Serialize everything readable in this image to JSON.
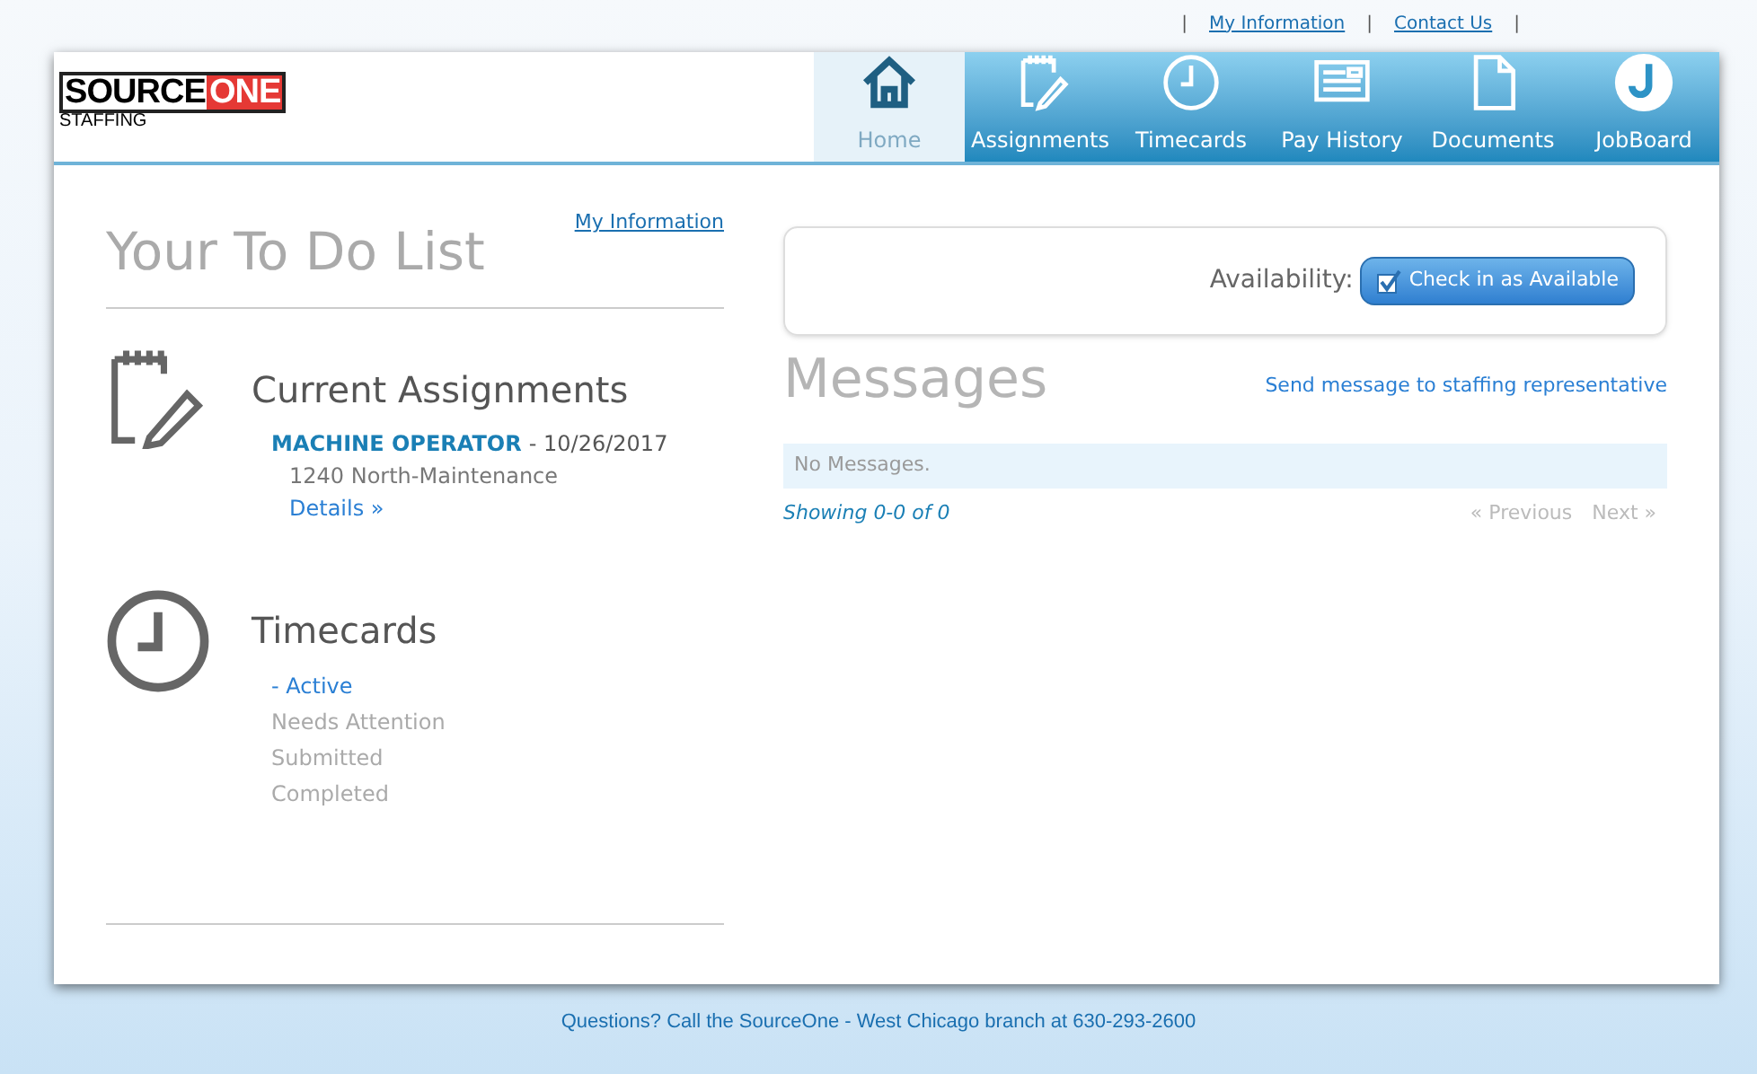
{
  "top_bar": [
    {
      "kind": "separator",
      "text": "|"
    },
    {
      "kind": "link",
      "text": "My Information"
    },
    {
      "kind": "separator",
      "text": "|"
    },
    {
      "kind": "link",
      "text": "Contact Us"
    },
    {
      "kind": "separator",
      "text": "|"
    }
  ],
  "logo": {
    "brand_a": "SOURCE",
    "brand_b": "ONE",
    "tagline": "STAFFING"
  },
  "nav": [
    {
      "label": "Home",
      "selected": true
    },
    {
      "label": "Assignments",
      "selected": false
    },
    {
      "label": "Timecards",
      "selected": false
    },
    {
      "label": "Pay History",
      "selected": false
    },
    {
      "label": "Documents",
      "selected": false
    },
    {
      "label": "JobBoard",
      "selected": false
    }
  ],
  "todo": {
    "title": "Your To Do List",
    "link": "My Information",
    "assignments": {
      "title": "Current Assignments",
      "job": "MACHINE OPERATOR",
      "date": "- 10/26/2017",
      "location": "1240 North-Maintenance",
      "details": "Details »"
    },
    "timecards": {
      "title": "Timecards",
      "items": [
        {
          "label": "- Active",
          "selected": true
        },
        {
          "label": "Needs Attention",
          "selected": false
        },
        {
          "label": "Submitted",
          "selected": false
        },
        {
          "label": "Completed",
          "selected": false
        }
      ]
    }
  },
  "availability": {
    "label": "Availability:",
    "button": "Check in as Available",
    "checked": true
  },
  "messages": {
    "title": "Messages",
    "send_link": "Send message to staffing representative",
    "empty": "No Messages.",
    "showing": "Showing 0-0 of 0",
    "pager": [
      {
        "label": "« Previous",
        "disabled": true
      },
      {
        "label": "Next »",
        "disabled": true
      }
    ]
  },
  "footer": "Questions? Call the SourceOne - West Chicago branch at 630-293-2600"
}
